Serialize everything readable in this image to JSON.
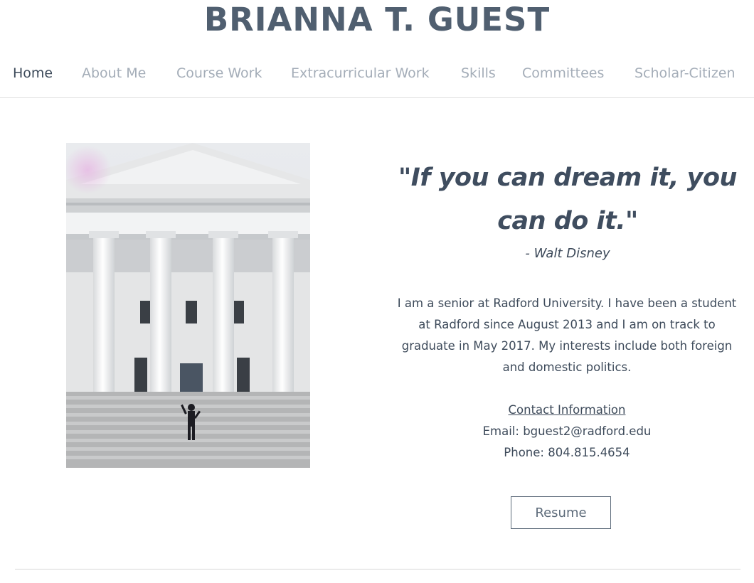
{
  "site": {
    "title": "BRIANNA T. GUEST"
  },
  "nav": {
    "items": [
      {
        "label": "Home",
        "active": true
      },
      {
        "label": "About Me"
      },
      {
        "label": "Course Work"
      },
      {
        "label": "Extracurricular Work"
      },
      {
        "label": "Skills"
      },
      {
        "label": "Committees"
      },
      {
        "label": "Scholar-Citizen"
      }
    ]
  },
  "quote": {
    "text": "\"If you can dream it, you can do it.\"",
    "author": "- Walt Disney"
  },
  "bio": "I am a senior at Radford University. I have been a student at Radford since August 2013 and I am on track to graduate in May 2017. My interests include both foreign and domestic politics.",
  "contact": {
    "heading": "Contact Information",
    "email": "Email: bguest2@radford.edu",
    "phone": "Phone: 804.815.4654"
  },
  "resume_button": "Resume",
  "colors": {
    "title": "#505f70",
    "nav_inactive": "#a4adb8",
    "text": "#3d4a5a"
  }
}
